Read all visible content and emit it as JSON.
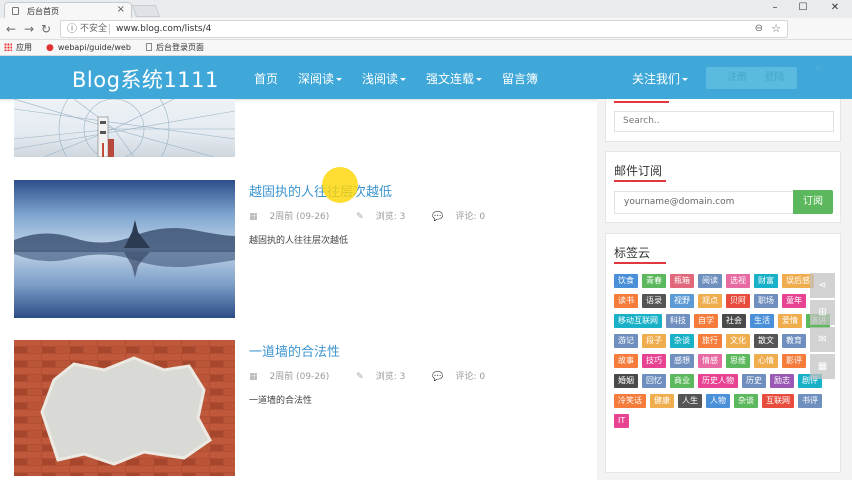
{
  "browser": {
    "tab_title": "后台首页",
    "tab_close": "×",
    "window_controls": [
      "–",
      "☐",
      "✕"
    ],
    "nav_icons": {
      "back": "←",
      "forward": "→",
      "reload": "↻"
    },
    "security_label": "不安全",
    "url": "www.blog.com/lists/4",
    "bookmarks": [
      "应用",
      "webapi/guide/web",
      "后台登录页面"
    ]
  },
  "header": {
    "brand": "Blog系统1111",
    "nav": [
      {
        "label": "首页",
        "dropdown": false
      },
      {
        "label": "深阅读",
        "dropdown": true
      },
      {
        "label": "浅阅读",
        "dropdown": true
      },
      {
        "label": "强文连载",
        "dropdown": true
      },
      {
        "label": "留言簿",
        "dropdown": false
      },
      {
        "label": "关注我们",
        "dropdown": true
      }
    ],
    "login_label": "注册",
    "register_label": "登陆"
  },
  "posts": [
    {
      "title": "越固执的人往往层次越低",
      "date": "2周前 (09-26)",
      "views": "浏览: 3",
      "comments": "评论: 0",
      "excerpt": "越固执的人往往层次越低"
    },
    {
      "title": "一道墙的合法性",
      "date": "2周前 (09-26)",
      "views": "浏览: 3",
      "comments": "评论: 0",
      "excerpt": "一道墙的合法性"
    }
  ],
  "sidebar": {
    "search_placeholder": "Search..",
    "subscribe": {
      "title": "邮件订阅",
      "placeholder": "yourname@domain.com",
      "button": "订阅"
    },
    "tags": {
      "title": "标签云",
      "items": [
        {
          "label": "饮食",
          "color": "#4a90d9"
        },
        {
          "label": "青春",
          "color": "#5cb85c"
        },
        {
          "label": "瓶箱",
          "color": "#e0687a"
        },
        {
          "label": "阅读",
          "color": "#6f8fbf"
        },
        {
          "label": "选视",
          "color": "#e86aa3"
        },
        {
          "label": "财富",
          "color": "#19b1c8"
        },
        {
          "label": "误后感",
          "color": "#f0ad4e"
        },
        {
          "label": "读书",
          "color": "#f57c3a"
        },
        {
          "label": "语录",
          "color": "#555555"
        },
        {
          "label": "视野",
          "color": "#5b9bd5"
        },
        {
          "label": "观点",
          "color": "#f0ad4e"
        },
        {
          "label": "贝阿",
          "color": "#e74c3c"
        },
        {
          "label": "职场",
          "color": "#6f8fbf"
        },
        {
          "label": "童年",
          "color": "#e84393"
        },
        {
          "label": "移动互联网",
          "color": "#19b1c8"
        },
        {
          "label": "科技",
          "color": "#6f8fbf"
        },
        {
          "label": "自学",
          "color": "#f57c3a"
        },
        {
          "label": "社会",
          "color": "#4a4a4a"
        },
        {
          "label": "生活",
          "color": "#4a90d9"
        },
        {
          "label": "爱情",
          "color": "#f0ad4e"
        },
        {
          "label": "演讲",
          "color": "#5cb85c"
        },
        {
          "label": "游记",
          "color": "#6f8fbf"
        },
        {
          "label": "段子",
          "color": "#f0ad4e"
        },
        {
          "label": "杂谈",
          "color": "#19b1c8"
        },
        {
          "label": "旅行",
          "color": "#f57c3a"
        },
        {
          "label": "文化",
          "color": "#f0ad4e"
        },
        {
          "label": "散文",
          "color": "#555555"
        },
        {
          "label": "教育",
          "color": "#6f8fbf"
        },
        {
          "label": "故事",
          "color": "#f57c3a"
        },
        {
          "label": "技巧",
          "color": "#e84393"
        },
        {
          "label": "感想",
          "color": "#6f8fbf"
        },
        {
          "label": "情感",
          "color": "#e86aa3"
        },
        {
          "label": "思维",
          "color": "#5cb85c"
        },
        {
          "label": "心情",
          "color": "#f0ad4e"
        },
        {
          "label": "影评",
          "color": "#f57c3a"
        },
        {
          "label": "婚姻",
          "color": "#4a4a4a"
        },
        {
          "label": "回忆",
          "color": "#6f8fbf"
        },
        {
          "label": "商业",
          "color": "#5cb85c"
        },
        {
          "label": "历史人物",
          "color": "#e84393"
        },
        {
          "label": "历史",
          "color": "#6f8fbf"
        },
        {
          "label": "励志",
          "color": "#9b59b6"
        },
        {
          "label": "剧评",
          "color": "#19b1c8"
        },
        {
          "label": "冷笑话",
          "color": "#f57c3a"
        },
        {
          "label": "健康",
          "color": "#f0ad4e"
        },
        {
          "label": "人生",
          "color": "#555555"
        },
        {
          "label": "人物",
          "color": "#4a90d9"
        },
        {
          "label": "杂谈",
          "color": "#5cb85c"
        },
        {
          "label": "互联网",
          "color": "#e74c3c"
        },
        {
          "label": "书评",
          "color": "#6f8fbf"
        },
        {
          "label": "IT",
          "color": "#e84393"
        }
      ]
    }
  },
  "float_tools": [
    "分享",
    "关注",
    "评论",
    "目录"
  ]
}
